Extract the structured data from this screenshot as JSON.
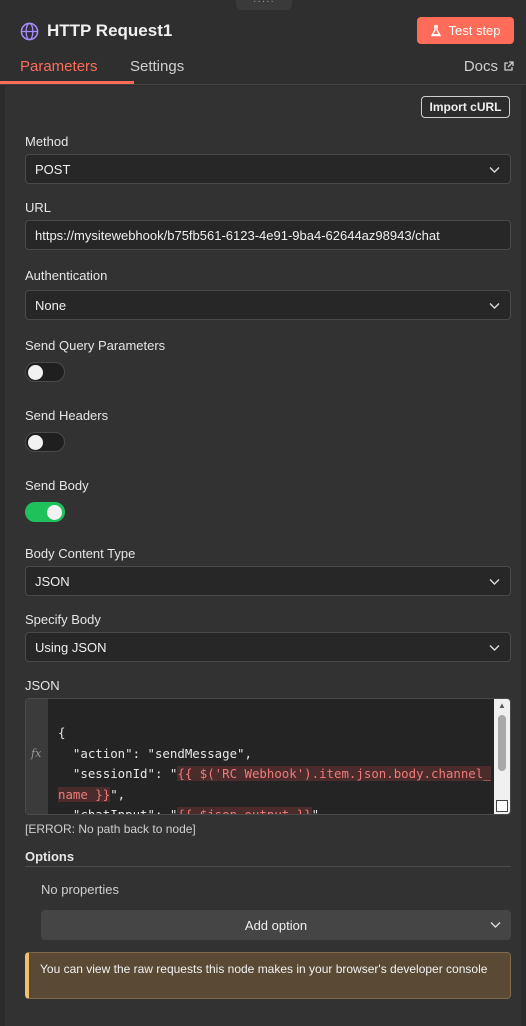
{
  "header": {
    "title": "HTTP Request1",
    "test_step_label": "Test step",
    "drag_handle_glyph": "·····",
    "icons": {
      "node": "globe-icon",
      "test_step": "flask-icon",
      "docs": "external-link-icon"
    }
  },
  "tabs": [
    {
      "label": "Parameters",
      "active": true
    },
    {
      "label": "Settings",
      "active": false
    }
  ],
  "docs_label": "Docs",
  "colors": {
    "accent": "#ff6d5a",
    "toggle_on": "#1ec15b",
    "notice_border": "#f0c070"
  },
  "import_curl_label": "Import cURL",
  "method": {
    "label": "Method",
    "value": "POST"
  },
  "url": {
    "label": "URL",
    "value": "https://mysitewebhook/b75fb561-6123-4e91-9ba4-62644az98943/chat"
  },
  "authentication": {
    "label": "Authentication",
    "value": "None"
  },
  "send_query_parameters": {
    "label": "Send Query Parameters",
    "enabled": false
  },
  "send_headers": {
    "label": "Send Headers",
    "enabled": false
  },
  "send_body": {
    "label": "Send Body",
    "enabled": true
  },
  "body_content_type": {
    "label": "Body Content Type",
    "value": "JSON"
  },
  "specify_body": {
    "label": "Specify Body",
    "value": "Using JSON"
  },
  "json": {
    "label": "JSON",
    "fx_label": "fx",
    "lines": {
      "l1": "{",
      "l2": "  \"action\": \"sendMessage\",",
      "l3_prefix": "  \"sessionId\": \"",
      "l3_expr": "{{ $('RC Webhook').item.json.body.channel_",
      "l4_expr": "name }}",
      "l4_suffix": "\",",
      "l5_prefix": "  \"chatInput\": \"",
      "l5_expr": "{{ $json.output }}",
      "l5_suffix": "\""
    }
  },
  "error_text": "[ERROR: No path back to node]",
  "options": {
    "title": "Options",
    "empty_text": "No properties",
    "add_option_label": "Add option"
  },
  "notice": "You can view the raw requests this node makes in your browser's developer console"
}
